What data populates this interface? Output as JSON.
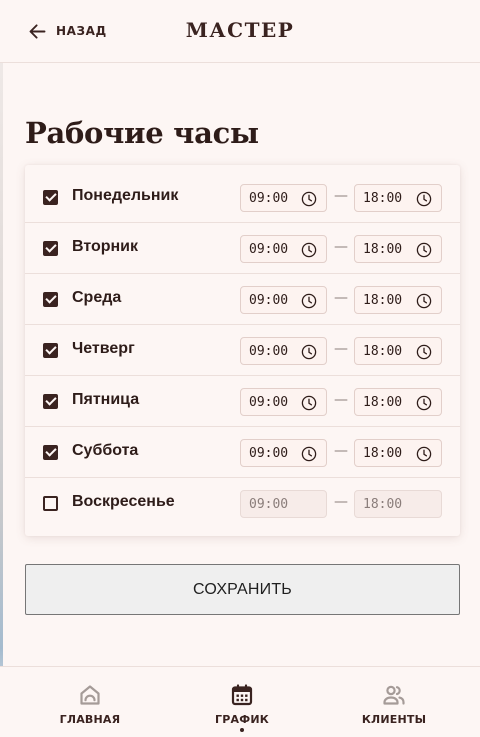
{
  "header": {
    "back_label": "НАЗАД",
    "app_title": "МАСТЕР"
  },
  "page": {
    "title": "Рабочие часы"
  },
  "schedule": {
    "days": [
      {
        "name": "Понедельник",
        "enabled": true,
        "start": "09:00",
        "end": "18:00"
      },
      {
        "name": "Вторник",
        "enabled": true,
        "start": "09:00",
        "end": "18:00"
      },
      {
        "name": "Среда",
        "enabled": true,
        "start": "09:00",
        "end": "18:00"
      },
      {
        "name": "Четверг",
        "enabled": true,
        "start": "09:00",
        "end": "18:00"
      },
      {
        "name": "Пятница",
        "enabled": true,
        "start": "09:00",
        "end": "18:00"
      },
      {
        "name": "Суббота",
        "enabled": true,
        "start": "09:00",
        "end": "18:00"
      },
      {
        "name": "Воскресенье",
        "enabled": false,
        "start": "09:00",
        "end": "18:00"
      }
    ],
    "separator": "—"
  },
  "actions": {
    "save_label": "СОХРАНИТЬ"
  },
  "nav": {
    "items": [
      {
        "label": "ГЛАВНАЯ",
        "icon": "home-icon",
        "active": false
      },
      {
        "label": "ГРАФИК",
        "icon": "calendar-icon",
        "active": true
      },
      {
        "label": "КЛИЕНТЫ",
        "icon": "people-icon",
        "active": false
      }
    ]
  },
  "colors": {
    "background": "#fdf6f4",
    "primary": "#3a2320",
    "inactive": "#a59b98",
    "divider": "#ecdfdb"
  }
}
